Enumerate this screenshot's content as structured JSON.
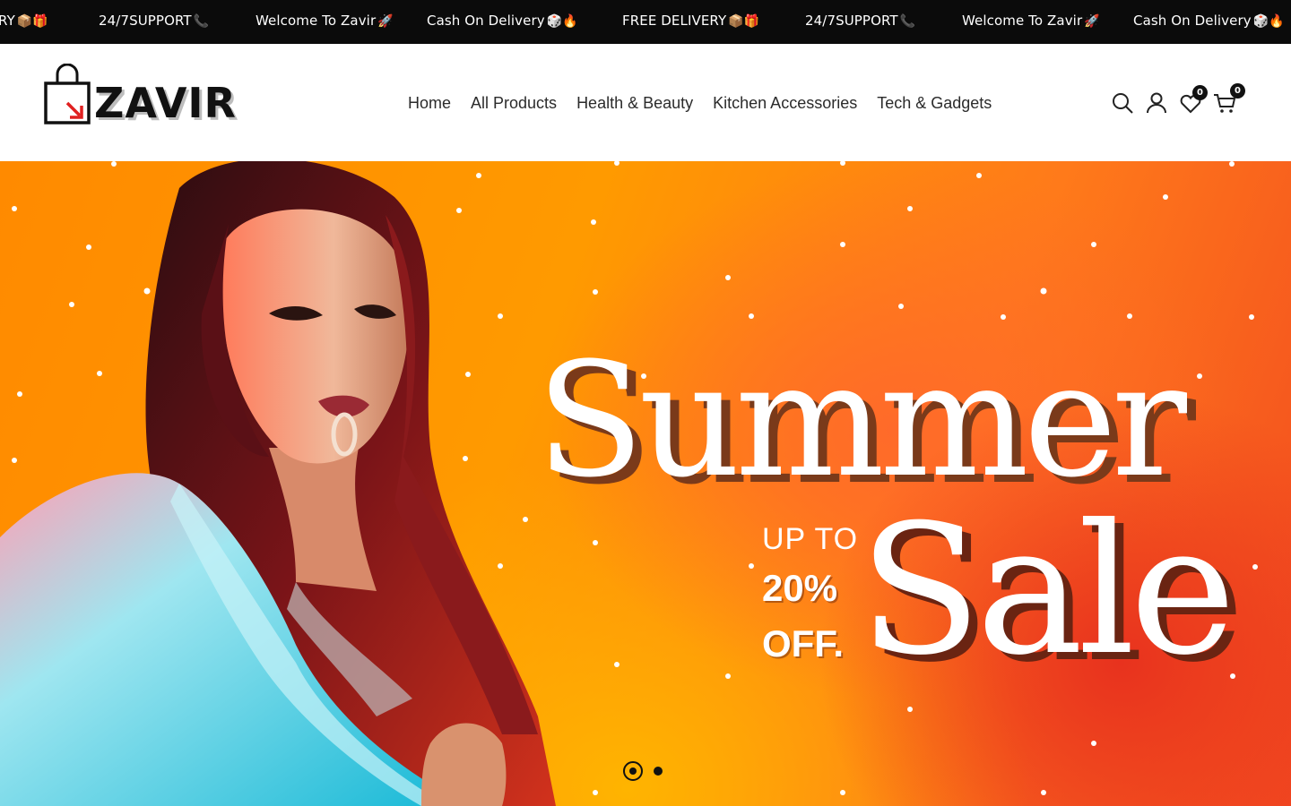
{
  "announcement_bar": {
    "items": [
      {
        "text": "RY",
        "emoji": "📦🎁"
      },
      {
        "text": "24/7SUPPORT",
        "emoji": "📞"
      },
      {
        "text": "Welcome To Zavir",
        "emoji": "🚀"
      },
      {
        "text": "Cash On Delivery",
        "emoji": "🎲🔥"
      },
      {
        "text": "FREE DELIVERY",
        "emoji": "📦🎁"
      },
      {
        "text": "24/7SUPPORT",
        "emoji": "📞"
      },
      {
        "text": "Welcome To Zavir",
        "emoji": "🚀"
      },
      {
        "text": "Cash On Delivery",
        "emoji": "🎲🔥"
      }
    ]
  },
  "header": {
    "logo_text": "ZAVIR",
    "nav": [
      "Home",
      "All Products",
      "Health & Beauty",
      "Kitchen Accessories",
      "Tech & Gadgets"
    ],
    "icons": {
      "search": "search-icon",
      "account": "user-icon",
      "wishlist": "heart-icon",
      "cart": "cart-icon"
    },
    "wishlist_count": "0",
    "cart_count": "0"
  },
  "hero": {
    "title_line1": "Summer",
    "title_line2": "Sale",
    "promo_upto": "UP TO",
    "promo_percent": "20%",
    "promo_off": "OFF.",
    "slides": 2,
    "active_slide": 1,
    "colors": {
      "orange": "#ff9a00",
      "red": "#e8321e"
    }
  }
}
